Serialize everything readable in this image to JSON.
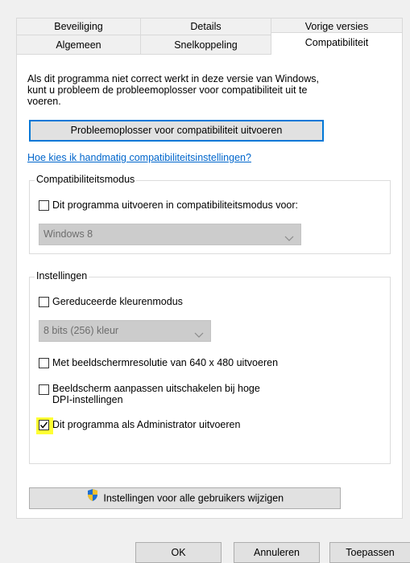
{
  "tabs": {
    "row1": [
      {
        "label": "Beveiliging"
      },
      {
        "label": "Details"
      },
      {
        "label": "Vorige versies"
      }
    ],
    "row2": [
      {
        "label": "Algemeen"
      },
      {
        "label": "Snelkoppeling"
      },
      {
        "label": "Compatibiliteit"
      }
    ]
  },
  "intro": {
    "line1": "Als dit programma niet correct werkt in deze versie van Windows,",
    "line2": "kunt u probleem de probleemoplosser voor compatibiliteit uit te",
    "line3": "voeren."
  },
  "troubleshoot_button": "Probleemoplosser voor compatibiliteit uitvoeren",
  "manual_link": "Hoe kies ik handmatig compatibiliteitsinstellingen?",
  "compat_mode": {
    "title": "Compatibiliteitsmodus",
    "checkbox_label": "Dit programma uitvoeren in compatibiliteitsmodus voor:",
    "checked": false,
    "select_value": "Windows 8"
  },
  "settings": {
    "title": "Instellingen",
    "reduced_color": {
      "label": "Gereduceerde kleurenmodus",
      "checked": false
    },
    "color_select_value": "8 bits (256) kleur",
    "resolution": {
      "label": "Met beeldschermresolutie van 640 x 480 uitvoeren",
      "checked": false
    },
    "dpi": {
      "label_line1": "Beeldscherm aanpassen uitschakelen bij hoge",
      "label_line2": "DPI-instellingen",
      "checked": false
    },
    "admin": {
      "label": "Dit programma als Administrator uitvoeren",
      "checked": true
    }
  },
  "all_users_button": "Instellingen voor alle gebruikers wijzigen",
  "footer": {
    "ok": "OK",
    "cancel": "Annuleren",
    "apply": "Toepassen"
  },
  "colors": {
    "accent": "#0078d7",
    "link": "#0066cc",
    "highlight": "#ffff33"
  }
}
